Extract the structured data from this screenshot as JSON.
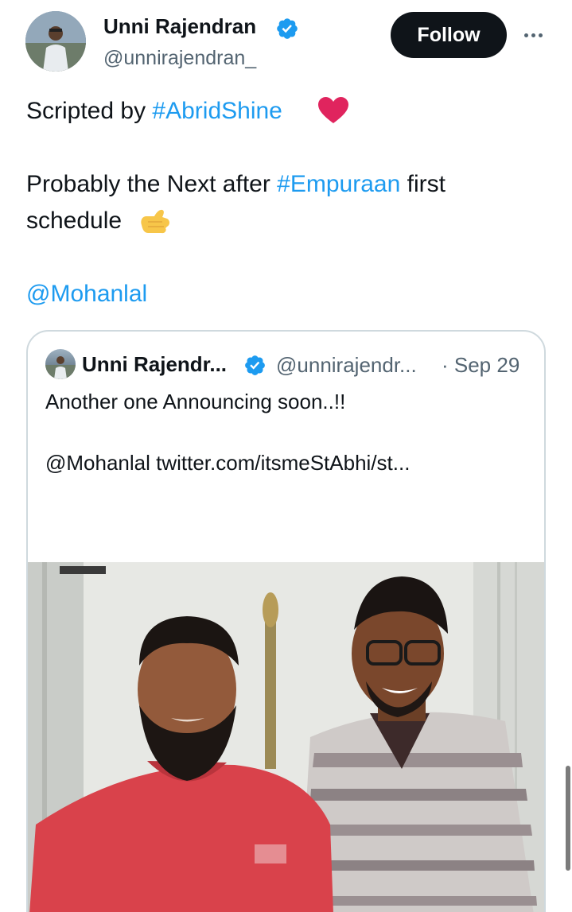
{
  "tweet": {
    "author_name": "Unni Rajendran",
    "author_handle": "@unnirajendran_",
    "follow_label": "Follow",
    "line1_text": "Scripted by ",
    "line1_hashtag": "#AbridShine",
    "line2_text": "Probably the Next after ",
    "line2_hashtag": "#Empuraan",
    "line2_after": " first",
    "line3_text": "schedule",
    "mention": "@Mohanlal"
  },
  "quote": {
    "author_name": "Unni Rajendr...",
    "author_handle": "@unnirajendr...",
    "date": "· Sep 29",
    "text": "Another one Announcing soon..!!",
    "mention_line": "@Mohanlal  twitter.com/itsmeStAbhi/st..."
  },
  "colors": {
    "link": "#1d9bf0",
    "verified": "#1d9bf0",
    "follow_bg": "#0f1419",
    "heart": "#e0245e"
  },
  "icons": [
    "verified-badge-icon",
    "more-options-icon",
    "red-heart-emoji",
    "call-me-hand-emoji"
  ]
}
